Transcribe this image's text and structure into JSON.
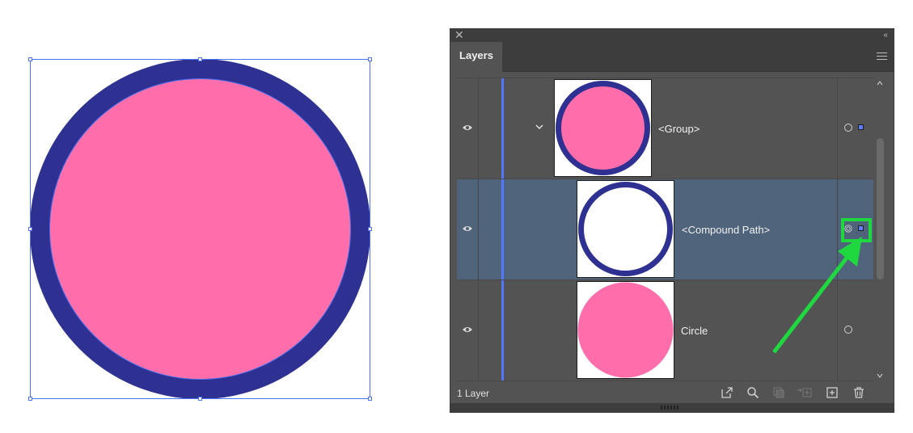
{
  "colors": {
    "artwork_fill": "#ff6eaa",
    "artwork_stroke": "#2e3192",
    "selection": "#4a72f0",
    "layer_color": "#5078ff",
    "highlight": "#1fd83f"
  },
  "panel": {
    "close_icon": "close-icon",
    "collapse_glyph": "‹‹",
    "tab_label": "Layers",
    "rows": [
      {
        "name": "<Group>",
        "selected": false,
        "expanded": true
      },
      {
        "name": "<Compound Path>",
        "selected": true,
        "expanded": false
      },
      {
        "name": "Circle",
        "selected": false,
        "expanded": false
      }
    ],
    "footer": {
      "layer_count": "1 Layer"
    }
  }
}
